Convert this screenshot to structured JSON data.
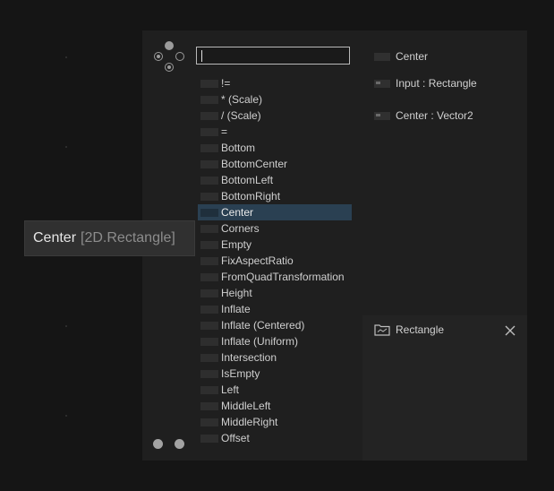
{
  "search": {
    "value": "",
    "placeholder": ""
  },
  "list": {
    "items": [
      {
        "label": "!="
      },
      {
        "label": "* (Scale)"
      },
      {
        "label": "/ (Scale)"
      },
      {
        "label": "="
      },
      {
        "label": "Bottom"
      },
      {
        "label": "BottomCenter"
      },
      {
        "label": "BottomLeft"
      },
      {
        "label": "BottomRight"
      },
      {
        "label": "Center",
        "selected": true
      },
      {
        "label": "Corners"
      },
      {
        "label": "Empty"
      },
      {
        "label": "FixAspectRatio"
      },
      {
        "label": "FromQuadTransformation"
      },
      {
        "label": "Height"
      },
      {
        "label": "Inflate"
      },
      {
        "label": "Inflate (Centered)"
      },
      {
        "label": "Inflate (Uniform)"
      },
      {
        "label": "Intersection"
      },
      {
        "label": "IsEmpty"
      },
      {
        "label": "Left"
      },
      {
        "label": "MiddleLeft"
      },
      {
        "label": "MiddleRight"
      },
      {
        "label": "Offset"
      }
    ]
  },
  "detail": {
    "title": "Center",
    "input": "Input : Rectangle",
    "output": "Center : Vector2"
  },
  "tooltip": {
    "name": "Center",
    "type": "[2D.Rectangle]"
  },
  "subpanel": {
    "title": "Rectangle",
    "icon": "folder-icon",
    "close_icon": "close-icon"
  },
  "colors": {
    "background": "#151515",
    "panel": "#1f1f1f",
    "selected": "#2a4052"
  }
}
